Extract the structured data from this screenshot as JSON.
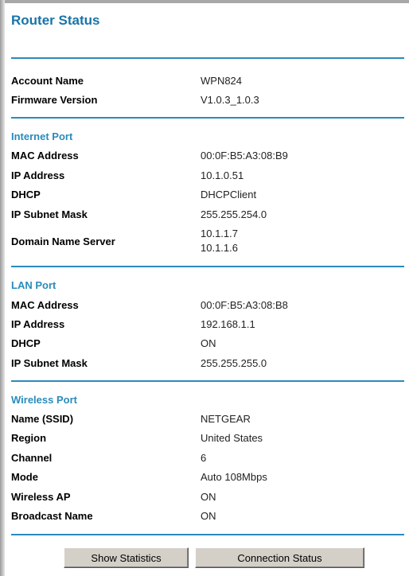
{
  "page": {
    "title": "Router Status"
  },
  "device": {
    "rows": [
      {
        "label": "Account Name",
        "value": "WPN824"
      },
      {
        "label": "Firmware Version",
        "value": "V1.0.3_1.0.3"
      }
    ]
  },
  "internet_port": {
    "title": "Internet Port",
    "mac_label": "MAC Address",
    "mac_value": "00:0F:B5:A3:08:B9",
    "ip_label": "IP Address",
    "ip_value": "10.1.0.51",
    "dhcp_label": "DHCP",
    "dhcp_value": "DHCPClient",
    "subnet_label": "IP Subnet Mask",
    "subnet_value": "255.255.254.0",
    "dns_label": "Domain Name Server",
    "dns_values": [
      "10.1.1.7",
      "10.1.1.6"
    ]
  },
  "lan_port": {
    "title": "LAN Port",
    "rows": [
      {
        "label": "MAC Address",
        "value": "00:0F:B5:A3:08:B8"
      },
      {
        "label": "IP Address",
        "value": "192.168.1.1"
      },
      {
        "label": "DHCP",
        "value": "ON"
      },
      {
        "label": "IP Subnet Mask",
        "value": "255.255.255.0"
      }
    ]
  },
  "wireless_port": {
    "title": "Wireless Port",
    "rows": [
      {
        "label": "Name (SSID)",
        "value": "NETGEAR"
      },
      {
        "label": "Region",
        "value": "United States"
      },
      {
        "label": "Channel",
        "value": "6"
      },
      {
        "label": "Mode",
        "value": "Auto 108Mbps"
      },
      {
        "label": "Wireless AP",
        "value": "ON"
      },
      {
        "label": "Broadcast Name",
        "value": "ON"
      }
    ]
  },
  "buttons": {
    "show_statistics": "Show Statistics",
    "connection_status": "Connection Status"
  },
  "colors": {
    "accent": "#2a8bbb",
    "title": "#1874a8",
    "button_face": "#d4d0c8"
  }
}
